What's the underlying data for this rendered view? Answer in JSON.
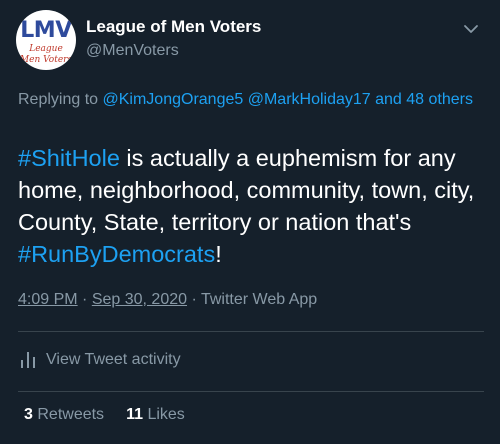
{
  "author": {
    "avatar": {
      "logo_text": "LMV",
      "subtext_line1": "League",
      "subtext_line2": "Men Voters"
    },
    "display_name": "League of Men Voters",
    "handle": "@MenVoters"
  },
  "reply_context": {
    "prefix": "Replying to",
    "users": [
      "@KimJongOrange5",
      "@MarkHoliday17"
    ],
    "others": "and 48 others"
  },
  "tweet": {
    "parts": [
      {
        "text": "#ShitHole",
        "type": "hashtag"
      },
      {
        "text": " is actually a euphemism for any home, neighborhood, community, town, city, County, State, territory or nation that's ",
        "type": "text"
      },
      {
        "text": "#RunByDemocrats",
        "type": "hashtag"
      },
      {
        "text": "!",
        "type": "text"
      }
    ]
  },
  "meta": {
    "time": "4:09 PM",
    "dot1": " · ",
    "date": "Sep 30, 2020",
    "dot2": " · ",
    "source": "Twitter Web App"
  },
  "activity": {
    "label": "View Tweet activity",
    "icon": "bar-chart-icon"
  },
  "stats": {
    "retweets_count": "3",
    "retweets_label": "Retweets",
    "likes_count": "11",
    "likes_label": "Likes"
  },
  "colors": {
    "background": "#15202b",
    "link": "#1da1f2",
    "secondary_text": "#8899a6",
    "divider": "#38444d"
  }
}
